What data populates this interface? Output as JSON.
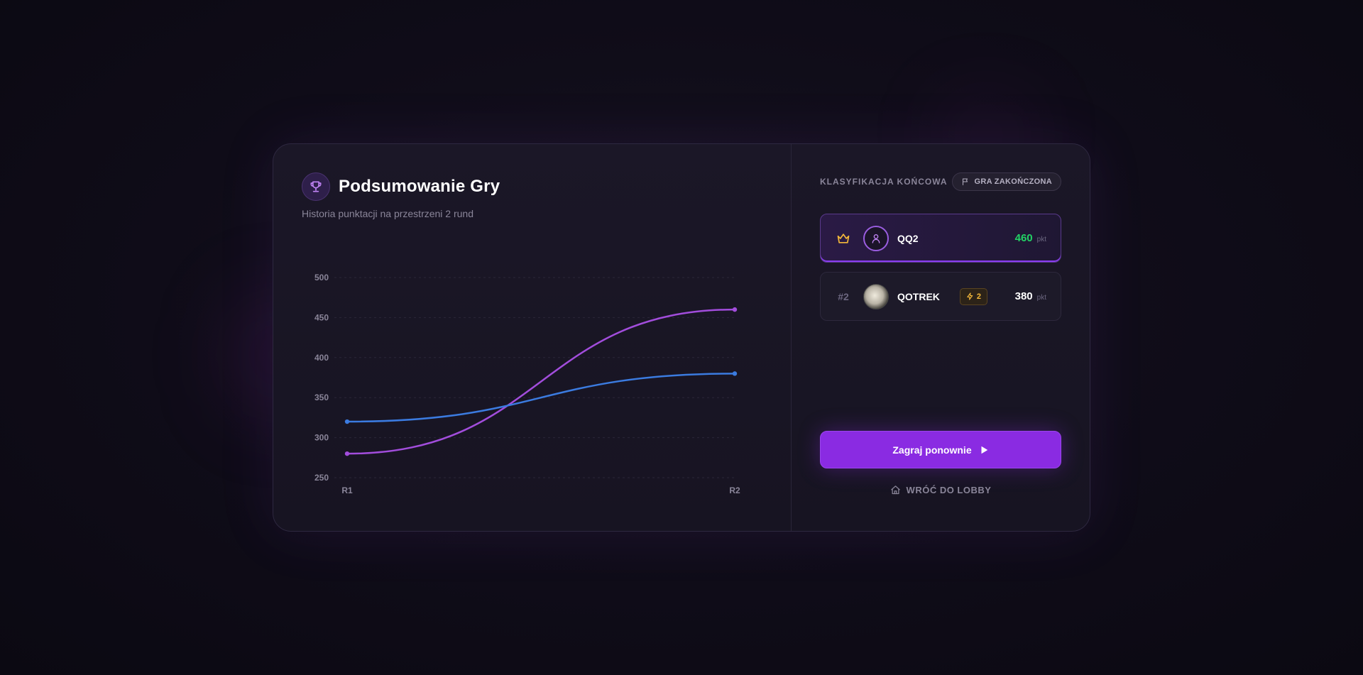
{
  "summary": {
    "title": "Podsumowanie Gry",
    "subtitle": "Historia punktacji na przestrzeni 2 rund"
  },
  "chart_data": {
    "type": "line",
    "x": [
      "R1",
      "R2"
    ],
    "series": [
      {
        "color": "#a24ddc",
        "values": [
          280,
          460
        ]
      },
      {
        "color": "#3b7be0",
        "values": [
          320,
          380
        ]
      }
    ],
    "yticks": [
      "500",
      "450",
      "400",
      "350",
      "300",
      "250"
    ],
    "ylim": [
      250,
      500
    ],
    "grid": true
  },
  "standings": {
    "label": "KLASYFIKACJA KOŃCOWA",
    "status": "GRA ZAKOŃCZONA",
    "players": [
      {
        "rank_icon": "crown-icon",
        "name": "QQ2",
        "score": "460",
        "unit": "pkt",
        "score_color": "#22d365"
      },
      {
        "rank": "#2",
        "name": "QOTREK",
        "streak": "2",
        "score": "380",
        "unit": "pkt",
        "score_color": "#ffffff"
      }
    ]
  },
  "actions": {
    "play_again": "Zagraj ponownie",
    "back_to_lobby": "WRÓĆ DO LOBBY"
  },
  "colors": {
    "accent": "#8a2be2",
    "gold": "#f5b93a",
    "winner_score": "#22d365"
  }
}
